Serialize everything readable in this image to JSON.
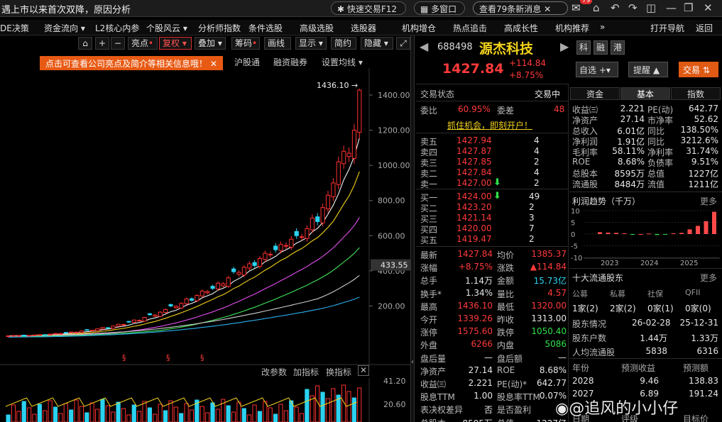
{
  "top": {
    "headline": "遇上市以来首次双降，原因分析",
    "quick_trade": "快速交易F12",
    "multi_window": "多窗口",
    "news": "查看79条新消息",
    "badge": "79"
  },
  "nav": [
    {
      "label": "DE决策"
    },
    {
      "label": "资金流向 ▾"
    },
    {
      "label": "L2核心内参"
    },
    {
      "label": "个股风云 ▾"
    },
    {
      "label": "分析师指数"
    },
    {
      "label": "条件选股"
    },
    {
      "label": "高级选股"
    },
    {
      "label": "选股器"
    },
    {
      "label": "机构增仓"
    },
    {
      "label": "热点追击"
    },
    {
      "label": "高成长性"
    },
    {
      "label": "机构推荐"
    },
    {
      "label": "»"
    },
    {
      "label": "打开导航"
    },
    {
      "label": "返回"
    }
  ],
  "toolbar": {
    "highlight": "亮点",
    "restore": "复权",
    "overlay": "叠加",
    "chips": "筹码",
    "draw": "画线",
    "display": "显示",
    "simple": "简约",
    "hide": "隐藏",
    "tooltip": "点击可查看公司亮点及简介等相关信息哦！",
    "hgt": "沪股通",
    "margin": "融资融券",
    "ma": "设置均线 ▾"
  },
  "chart": {
    "price_ticks": [
      "1400.00",
      "1200.00",
      "1000.00",
      "800.00",
      "600.00",
      "400.00",
      "200.00"
    ],
    "current_tag": "433.55",
    "peak_label": "1436.10",
    "mark": "§",
    "sub_labels": {
      "param": "改参数",
      "add": "加指标",
      "switch": "换指标"
    },
    "vol_ticks": [
      "41.20",
      "20.60"
    ]
  },
  "chart_data": {
    "type": "candlestick",
    "close": [
      30,
      32,
      31,
      33,
      32,
      35,
      37,
      36,
      40,
      44,
      42,
      48,
      52,
      50,
      58,
      63,
      60,
      70,
      78,
      74,
      86,
      96,
      92,
      108,
      120,
      115,
      135,
      150,
      142,
      165,
      180,
      200,
      190,
      215,
      240,
      232,
      260,
      285,
      275,
      300,
      330,
      315,
      360,
      395,
      380,
      420,
      440,
      430,
      470,
      500,
      490,
      520,
      550,
      540,
      580,
      600,
      590,
      640,
      700,
      680,
      760,
      830,
      900,
      1020,
      1080,
      1050,
      1200,
      1427.84
    ],
    "peak": 1436.1
  },
  "quote": {
    "code": "688498",
    "name": "源杰科技",
    "price": "1427.84",
    "change": "+114.84",
    "pct": "+8.75%",
    "side_tags": [
      "科",
      "融",
      "港"
    ],
    "btn_watch": "自选 +▾",
    "btn_alert": "提醒 ▲",
    "btn_trade": "交易 ⇅"
  },
  "order": {
    "status_label": "交易状态",
    "status_val": "交易中",
    "wb_label": "委比",
    "wb_val": "60.95%",
    "wc_label": "委差",
    "wc_val": "48",
    "open_acc": "抓住机会，即刻开户！",
    "sells": [
      {
        "label": "卖五",
        "price": "1427.94",
        "vol": "4"
      },
      {
        "label": "卖四",
        "price": "1427.87",
        "vol": "4"
      },
      {
        "label": "卖三",
        "price": "1427.85",
        "vol": "2"
      },
      {
        "label": "卖二",
        "price": "1427.84",
        "vol": "4"
      },
      {
        "label": "卖一",
        "price": "1427.00",
        "vol": "2"
      }
    ],
    "buys": [
      {
        "label": "买一",
        "price": "1424.00",
        "vol": "49"
      },
      {
        "label": "买二",
        "price": "1423.20",
        "vol": "2"
      },
      {
        "label": "买三",
        "price": "1421.14",
        "vol": "3"
      },
      {
        "label": "买四",
        "price": "1420.00",
        "vol": "7"
      },
      {
        "label": "买五",
        "price": "1419.47",
        "vol": "2"
      }
    ]
  },
  "stats": [
    {
      "l1": "最新",
      "v1": "1427.84",
      "l2": "均价",
      "v2": "1385.37"
    },
    {
      "l1": "涨幅",
      "v1": "+8.75%",
      "l2": "涨跌",
      "v2": "▲114.84"
    },
    {
      "l1": "总手",
      "v1": "1.14万",
      "l2": "金额",
      "v2": "15.73亿"
    },
    {
      "l1": "换手*",
      "v1": "1.34%",
      "l2": "量比",
      "v2": "4.57"
    },
    {
      "l1": "最高",
      "v1": "1436.10",
      "l2": "最低",
      "v2": "1320.00"
    },
    {
      "l1": "今开",
      "v1": "1339.26",
      "l2": "昨收",
      "v2": "1313.00"
    },
    {
      "l1": "涨停",
      "v1": "1575.60",
      "l2": "跌停",
      "v2": "1050.40"
    },
    {
      "l1": "外盘",
      "v1": "6266",
      "l2": "内盘",
      "v2": "5086"
    },
    {
      "l1": "盘后量",
      "v1": "—",
      "l2": "盘后额",
      "v2": "—"
    },
    {
      "l1": "净资产",
      "v1": "27.14",
      "l2": "ROE",
      "v2": "8.68%"
    },
    {
      "l1": "收益㈢",
      "v1": "2.221",
      "l2": "PE(动)*",
      "v2": "642.77"
    },
    {
      "l1": "股息TTM",
      "v1": "1.00",
      "l2": "股息率TTM",
      "v2": "0.07%"
    },
    {
      "l1": "表决权差异",
      "v1": "否",
      "l2": "是否盈利",
      "v2": ""
    },
    {
      "l1": "总股本",
      "v1": "8595万",
      "l2": "总值",
      "v2": "1227亿"
    }
  ],
  "tabs": [
    "资金",
    "基本",
    "指数"
  ],
  "fund": [
    {
      "l1": "收益㈢",
      "v1": "2.221",
      "l2": "PE(动)",
      "v2": "642.77"
    },
    {
      "l1": "净资产",
      "v1": "27.14",
      "l2": "市净率",
      "v2": "52.62"
    },
    {
      "l1": "总收入",
      "v1": "6.01亿",
      "l2": "同比",
      "v2": "138.50%"
    },
    {
      "l1": "净利润",
      "v1": "1.91亿",
      "l2": "同比",
      "v2": "3212.6%"
    },
    {
      "l1": "毛利率",
      "v1": "58.11%",
      "l2": "净利率",
      "v2": "31.74%"
    },
    {
      "l1": "ROE",
      "v1": "8.68%",
      "l2": "负债率",
      "v2": "9.51%"
    },
    {
      "l1": "总股本",
      "v1": "8595万",
      "l2": "总值",
      "v2": "1227亿"
    },
    {
      "l1": "流通股",
      "v1": "8484万",
      "l2": "流值",
      "v2": "1211亿"
    }
  ],
  "profit": {
    "title": "利润趋势（千万）",
    "more": "更多",
    "yticks": [
      "10",
      "5",
      "0",
      "-5",
      "-10"
    ],
    "years": [
      "2023",
      "2024",
      "2025"
    ],
    "values": [
      0.8,
      0.6,
      0.5,
      0.3,
      -0.2,
      0,
      0.2,
      -0.4,
      -0.3,
      0.3,
      0.5,
      2.0,
      3.5,
      5.5,
      9.5
    ]
  },
  "holders": {
    "title": "十大流通股东",
    "more": "更多",
    "headers": [
      "公募",
      "私募",
      "社保",
      "QFII"
    ],
    "values": [
      "1家(2)",
      "2家(2)",
      "0家(1)",
      "0家(0)"
    ],
    "rows": [
      {
        "label": "股东情况",
        "a": "26-02-28",
        "b": "25-12-31"
      },
      {
        "label": "股东户数",
        "a": "1.44万",
        "b": "1.33万"
      },
      {
        "label": "人均流通股",
        "a": "5838",
        "b": "6316"
      }
    ]
  },
  "forecast": {
    "headers": [
      "年份",
      "预测收益",
      "预测额"
    ],
    "rows": [
      {
        "year": "2028",
        "eps": "9.46",
        "amt": "138.83"
      },
      {
        "year": "2027",
        "eps": "6.89",
        "amt": "191.24"
      }
    ],
    "tail": [
      "日期",
      "评级",
      "目标价"
    ]
  },
  "watermark": "@追风的小小仔"
}
